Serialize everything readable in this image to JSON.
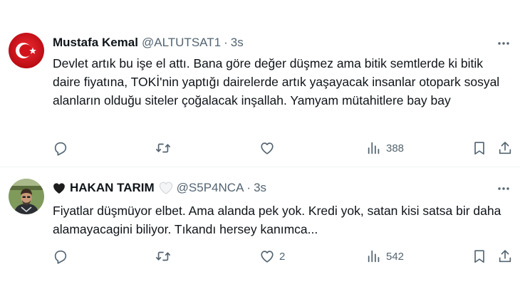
{
  "tweets": [
    {
      "name": "Mustafa Kemal",
      "handle": "@ALTUTSAT1",
      "separator": "·",
      "time": "3s",
      "text": "Devlet artık bu işe el attı. Bana göre değer düşmez ama bitik semtlerde ki bitik daire fiyatına, TOKİ'nin yaptığı dairelerde artık yaşayacak insanlar otopark sosyal alanların olduğu siteler çoğalacak inşallah. Yamyam mütahitlere bay bay",
      "replies": "",
      "retweets": "",
      "likes": "",
      "views": "388"
    },
    {
      "name": "HAKAN TARIM",
      "handle": "@S5P4NCA",
      "separator": "·",
      "time": "3s",
      "text": "Fiyatlar düşmüyor elbet. Ama alanda pek yok. Kredi yok, satan kisi satsa bir daha alamayacagini biliyor. Tıkandı hersey kanımca...",
      "replies": "",
      "retweets": "",
      "likes": "2",
      "views": "542"
    }
  ],
  "colors": {
    "text": "#0f1419",
    "secondary": "#536471",
    "divider": "#eff3f4",
    "flag_red": "#e30a17"
  },
  "icons": {
    "reply": "reply-icon",
    "retweet": "retweet-icon",
    "like": "heart-icon",
    "views": "views-icon",
    "bookmark": "bookmark-icon",
    "share": "share-icon",
    "more": "more-icon"
  }
}
